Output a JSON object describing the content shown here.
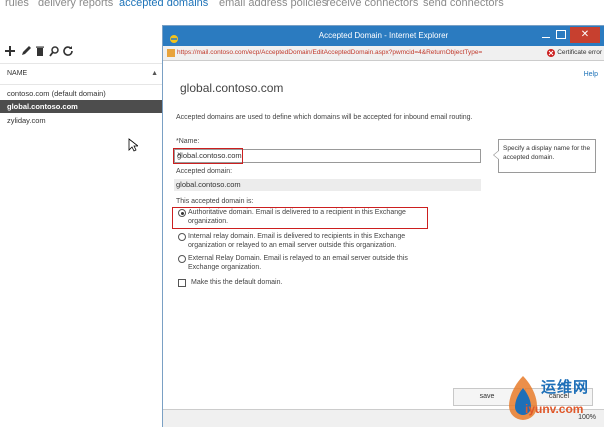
{
  "topnav": {
    "items": [
      "rules",
      "delivery reports",
      "accepted domains",
      "email address policies",
      "receive connectors",
      "send connectors"
    ],
    "active_index": 2
  },
  "left_pane": {
    "toolbar_icons": [
      "add-icon",
      "edit-icon",
      "delete-icon",
      "search-icon",
      "refresh-icon"
    ],
    "column_header": "NAME",
    "rows": [
      {
        "label": "contoso.com (default domain)",
        "selected": false
      },
      {
        "label": "global.contoso.com",
        "selected": true
      },
      {
        "label": "zyliday.com",
        "selected": false
      }
    ]
  },
  "dialog": {
    "title": "Accepted Domain - Internet Explorer",
    "url": "https://mail.contoso.com/ecp/AcceptedDomain/EditAcceptedDomain.aspx?pwmcid=4&ReturnObjectType=",
    "cert_text": "Certificate error",
    "help": "Help",
    "heading": "global.contoso.com",
    "description": "Accepted domains are used to define which domains will be accepted for inbound email routing.",
    "name_label": "*Name:",
    "name_value": "global.contoso.com",
    "accepted_label": "Accepted domain:",
    "accepted_value": "global.contoso.com",
    "type_label": "This accepted domain is:",
    "options": [
      {
        "text": "Authoritative domain. Email is delivered to a recipient in this Exchange organization.",
        "selected": true
      },
      {
        "text": "Internal relay domain. Email is delivered to recipients in this Exchange organization or relayed to an email server outside this organization.",
        "selected": false
      },
      {
        "text": "External Relay Domain. Email is relayed to an email server outside this Exchange organization.",
        "selected": false
      }
    ],
    "default_checkbox": "Make this the default domain.",
    "tooltip": "Specify a display name for the accepted domain.",
    "save": "save",
    "cancel": "cancel",
    "zoom": "100%"
  },
  "watermark": {
    "cn": "运维网",
    "en": "iyunv.com"
  },
  "colors": {
    "accent": "#1e73b8",
    "titlebar": "#2b7bc0",
    "highlight": "#cc1f1f",
    "selected_row": "#4d4d4d"
  }
}
